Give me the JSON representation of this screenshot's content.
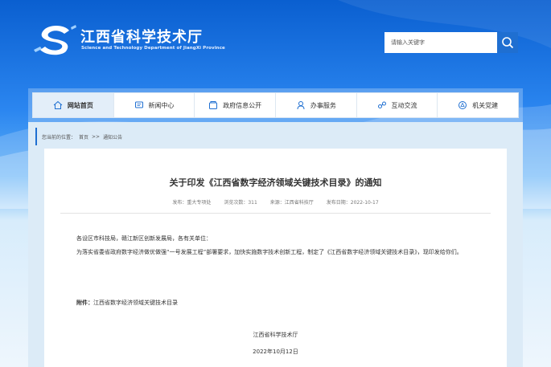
{
  "site": {
    "title": "江西省科学技术厅",
    "subtitle": "Science and Technology Department of JiangXi Province"
  },
  "search": {
    "placeholder": "请输入关键字"
  },
  "nav": [
    {
      "label": "网站首页",
      "icon": "home-icon"
    },
    {
      "label": "新闻中心",
      "icon": "message-icon"
    },
    {
      "label": "政府信息公开",
      "icon": "folder-icon"
    },
    {
      "label": "办事服务",
      "icon": "person-icon"
    },
    {
      "label": "互动交流",
      "icon": "interaction-icon"
    },
    {
      "label": "机关党建",
      "icon": "emblem-icon"
    }
  ],
  "breadcrumb": {
    "prefix": "您当前的位置：",
    "home": "首页",
    "sep": ">>",
    "current": "通知公告"
  },
  "article": {
    "title": "关于印发《江西省数字经济领域关键技术目录》的通知",
    "meta_publisher": "发布：重大专项处",
    "meta_views": "浏览次数：311",
    "meta_source": "来源：江西省科技厅",
    "meta_date": "发布日期：2022-10-17",
    "greeting": "各设区市科技局，赣江新区创新发展局，各有关单位：",
    "body": "为落实省委省政府数字经济做优做强“一号发展工程”部署要求，加快实施数字技术创新工程，制定了《江西省数字经济领域关键技术目录》，现印发给你们。",
    "attachment_label": "附件：",
    "attachment_name": "江西省数字经济领域关键技术目录",
    "signature": "江西省科学技术厅",
    "sign_date": "2022年10月12日"
  },
  "colors": {
    "brand_blue": "#1f6fd1",
    "nav_active_bg": "#e3eef9"
  }
}
